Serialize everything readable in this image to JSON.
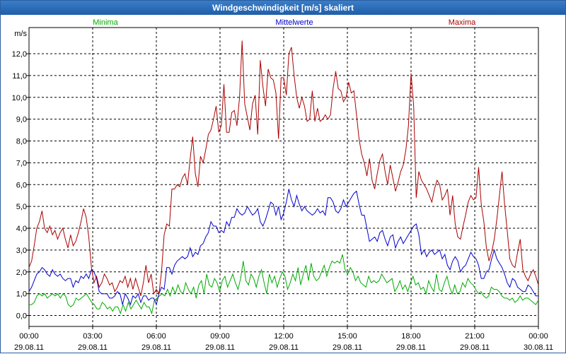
{
  "window": {
    "title": "Windgeschwindigkeit [m/s] skaliert"
  },
  "chart_data": {
    "type": "line",
    "title": "Windgeschwindigkeit [m/s] skaliert",
    "ylabel": "m/s",
    "ylim": [
      -0.5,
      13.2
    ],
    "xlim": [
      0,
      24
    ],
    "grid": true,
    "legend_placement": "top",
    "y_ticks": [
      "0,0",
      "1,0",
      "2,0",
      "3,0",
      "4,0",
      "5,0",
      "6,0",
      "7,0",
      "8,0",
      "9,0",
      "10,0",
      "11,0",
      "12,0"
    ],
    "x_ticks": [
      {
        "time": "00:00",
        "date": "29.08.11"
      },
      {
        "time": "03:00",
        "date": "29.08.11"
      },
      {
        "time": "06:00",
        "date": "29.08.11"
      },
      {
        "time": "09:00",
        "date": "29.08.11"
      },
      {
        "time": "12:00",
        "date": "29.08.11"
      },
      {
        "time": "15:00",
        "date": "29.08.11"
      },
      {
        "time": "18:00",
        "date": "29.08.11"
      },
      {
        "time": "21:00",
        "date": "29.08.11"
      },
      {
        "time": "00:00",
        "date": "30.08.11"
      }
    ],
    "series": [
      {
        "name": "Minima",
        "color": "#00aa00",
        "values": [
          0.5,
          0.5,
          0.6,
          0.9,
          1.0,
          0.9,
          1.0,
          0.8,
          0.9,
          1.0,
          0.9,
          1.0,
          0.8,
          1.0,
          0.9,
          0.5,
          0.4,
          0.5,
          0.8,
          0.7,
          0.8,
          0.9,
          1.0,
          0.8,
          0.6,
          0.5,
          0.3,
          0.3,
          0.6,
          0.5,
          0.3,
          0.4,
          0.2,
          0.4,
          0.4,
          0.1,
          0.5,
          0.2,
          0.6,
          0.3,
          0.5,
          0.7,
          0.5,
          0.3,
          0.6,
          0.4,
          0.4,
          0.1,
          0.7,
          0.8,
          0.9,
          1.0,
          0.9,
          1.2,
          0.9,
          1.3,
          1.0,
          1.4,
          1.1,
          1.0,
          1.5,
          1.2,
          1.0,
          1.3,
          0.8,
          1.4,
          1.6,
          1.0,
          1.9,
          1.4,
          1.3,
          1.7,
          1.5,
          1.1,
          1.6,
          1.8,
          1.3,
          1.6,
          1.9,
          1.5,
          1.2,
          1.7,
          2.5,
          1.6,
          1.4,
          1.9,
          1.7,
          1.3,
          1.8,
          2.1,
          1.5,
          1.0,
          1.9,
          1.5,
          1.8,
          1.3,
          1.7,
          2.0,
          1.8,
          1.2,
          1.5,
          1.9,
          1.6,
          2.2,
          1.4,
          1.9,
          2.3,
          1.6,
          2.4,
          1.8,
          1.6,
          1.7,
          2.0,
          2.3,
          1.8,
          2.2,
          2.5,
          2.4,
          2.5,
          2.4,
          2.8,
          2.1,
          1.9,
          2.2,
          2.0,
          1.6,
          1.8,
          1.5,
          1.4,
          1.3,
          1.8,
          1.5,
          1.6,
          1.5,
          1.6,
          1.9,
          1.7,
          1.5,
          1.6,
          1.7,
          1.1,
          1.3,
          1.6,
          1.2,
          1.4,
          1.1,
          1.5,
          1.8,
          1.4,
          1.5,
          1.2,
          1.3,
          1.0,
          1.6,
          1.3,
          1.1,
          1.9,
          1.2,
          1.1,
          1.5,
          1.8,
          1.3,
          1.0,
          1.4,
          1.0,
          1.1,
          1.5,
          1.3,
          1.7,
          1.5,
          1.4,
          1.2,
          1.0,
          1.1,
          0.9,
          0.8,
          0.9,
          1.3,
          1.2,
          1.2,
          1.1,
          0.9,
          0.8,
          0.8,
          0.7,
          0.8,
          0.6,
          0.7,
          0.9,
          0.7,
          0.8,
          0.8,
          0.7,
          0.6,
          0.5,
          0.7
        ]
      },
      {
        "name": "Mittelwerte",
        "color": "#0000cc",
        "values": [
          1.1,
          1.3,
          1.6,
          1.9,
          2.0,
          2.2,
          2.1,
          1.9,
          1.8,
          2.1,
          1.9,
          1.8,
          1.9,
          1.7,
          1.6,
          1.7,
          1.7,
          1.3,
          1.6,
          1.5,
          1.8,
          1.7,
          1.9,
          1.7,
          2.1,
          2.0,
          1.7,
          1.1,
          1.0,
          1.0,
          1.0,
          0.8,
          0.8,
          0.9,
          1.1,
          1.0,
          0.5,
          1.0,
          0.8,
          0.5,
          0.9,
          0.8,
          1.0,
          0.6,
          0.9,
          0.9,
          0.7,
          0.8,
          0.8,
          0.5,
          1.0,
          1.3,
          1.2,
          2.2,
          2.2,
          1.9,
          2.3,
          2.5,
          2.6,
          2.7,
          2.6,
          2.7,
          3.1,
          2.7,
          2.9,
          2.8,
          3.2,
          3.3,
          3.6,
          3.8,
          4.3,
          4.1,
          4.1,
          3.8,
          3.9,
          3.8,
          4.3,
          4.1,
          4.5,
          4.5,
          4.9,
          4.7,
          4.6,
          4.7,
          5.0,
          4.8,
          4.6,
          4.7,
          4.9,
          4.3,
          4.1,
          4.4,
          4.8,
          5.2,
          5.1,
          4.6,
          5.0,
          4.4,
          4.7,
          5.2,
          5.8,
          5.3,
          5.0,
          5.5,
          5.1,
          4.8,
          5.0,
          4.8,
          4.7,
          4.6,
          4.7,
          4.9,
          4.7,
          4.8,
          4.6,
          5.4,
          5.4,
          5.2,
          4.8,
          4.7,
          4.9,
          5.3,
          5.0,
          5.2,
          5.4,
          5.6,
          5.7,
          5.1,
          4.6,
          4.6,
          4.0,
          3.4,
          3.5,
          3.6,
          3.4,
          3.8,
          3.9,
          3.5,
          3.2,
          3.6,
          3.7,
          3.1,
          3.4,
          3.6,
          3.3,
          3.5,
          3.7,
          3.9,
          4.1,
          4.2,
          3.7,
          2.8,
          3.0,
          2.7,
          2.9,
          3.0,
          2.8,
          2.9,
          3.0,
          2.6,
          2.8,
          2.3,
          2.1,
          2.5,
          2.7,
          2.5,
          2.0,
          2.2,
          2.3,
          2.6,
          2.9,
          2.7,
          2.6,
          2.3,
          1.7,
          1.7,
          2.0,
          2.1,
          2.6,
          3.0,
          2.6,
          2.4,
          2.2,
          1.9,
          1.5,
          1.3,
          1.7,
          1.6,
          1.3,
          1.2,
          1.1,
          1.1,
          1.4,
          1.3,
          1.1,
          0.9,
          0.9
        ]
      },
      {
        "name": "Maxima",
        "color": "#aa0000",
        "values": [
          2.2,
          2.5,
          3.2,
          4.0,
          4.3,
          4.8,
          4.0,
          3.8,
          4.1,
          3.7,
          3.9,
          3.5,
          3.8,
          4.0,
          3.5,
          3.1,
          3.7,
          3.2,
          3.4,
          3.8,
          4.3,
          4.9,
          4.5,
          3.6,
          2.2,
          1.5,
          1.8,
          1.3,
          1.5,
          1.9,
          1.7,
          1.4,
          1.5,
          1.1,
          1.3,
          1.6,
          1.5,
          1.8,
          1.3,
          1.7,
          1.2,
          1.7,
          1.3,
          0.9,
          1.5,
          2.3,
          1.5,
          1.9,
          1.0,
          1.2,
          1.0,
          2.0,
          3.7,
          4.2,
          4.1,
          5.8,
          5.8,
          6.0,
          5.9,
          6.3,
          6.5,
          6.0,
          7.2,
          8.2,
          6.5,
          5.9,
          7.3,
          7.0,
          7.6,
          8.3,
          8.5,
          9.0,
          9.6,
          8.4,
          8.7,
          10.6,
          8.4,
          8.4,
          9.3,
          9.4,
          8.7,
          10.0,
          12.6,
          9.7,
          9.1,
          8.5,
          9.7,
          10.1,
          8.3,
          11.7,
          10.5,
          9.6,
          11.3,
          10.9,
          10.8,
          10.2,
          8.1,
          10.9,
          10.9,
          10.1,
          12.0,
          12.3,
          11.0,
          10.0,
          9.5,
          10.0,
          9.6,
          8.9,
          9.0,
          10.3,
          8.9,
          9.5,
          8.9,
          9.0,
          9.2,
          9.0,
          9.2,
          10.4,
          11.2,
          10.4,
          10.3,
          9.8,
          10.0,
          10.7,
          10.2,
          10.3,
          9.2,
          8.1,
          7.4,
          7.0,
          6.4,
          7.2,
          6.2,
          5.8,
          6.5,
          7.1,
          7.4,
          6.6,
          6.0,
          6.9,
          6.3,
          5.7,
          6.1,
          6.6,
          6.9,
          7.6,
          8.7,
          11.1,
          9.6,
          5.4,
          6.6,
          6.2,
          6.0,
          5.8,
          5.5,
          5.2,
          5.8,
          6.2,
          6.0,
          5.3,
          5.5,
          5.8,
          4.6,
          5.5,
          4.2,
          3.6,
          3.5,
          4.1,
          4.6,
          5.2,
          5.5,
          5.3,
          5.4,
          6.8,
          5.1,
          4.3,
          3.1,
          2.5,
          2.9,
          3.5,
          4.4,
          5.5,
          6.6,
          5.1,
          3.9,
          2.6,
          2.3,
          2.2,
          2.9,
          3.5,
          2.1,
          1.8,
          1.6,
          1.9,
          2.1,
          1.8,
          1.4
        ]
      }
    ]
  }
}
